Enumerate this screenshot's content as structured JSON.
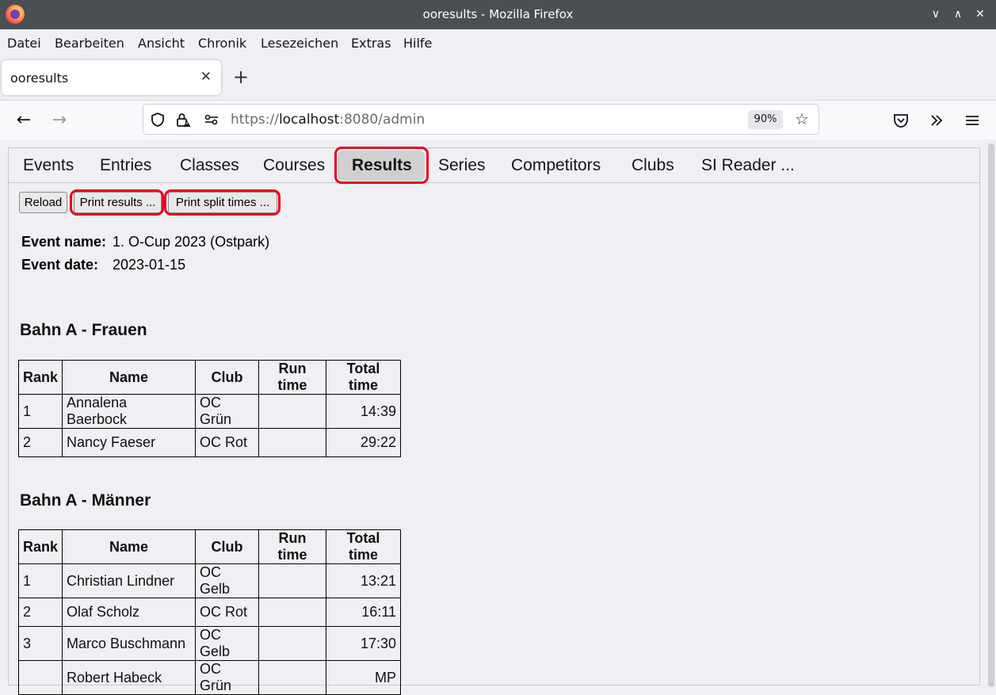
{
  "window": {
    "title": "ooresults - Mozilla Firefox"
  },
  "menu": [
    "Datei",
    "Bearbeiten",
    "Ansicht",
    "Chronik",
    "Lesezeichen",
    "Extras",
    "Hilfe"
  ],
  "tab": {
    "title": "ooresults"
  },
  "nav": {
    "url_scheme": "https://",
    "url_host": "localhost",
    "url_rest": ":8080/admin",
    "zoom": "90%"
  },
  "app_tabs": [
    "Events",
    "Entries",
    "Classes",
    "Courses",
    "Results",
    "Series",
    "Competitors",
    "Clubs",
    "SI Reader ..."
  ],
  "active_tab": "Results",
  "buttons": {
    "reload": "Reload",
    "print_results": "Print results ...",
    "print_split": "Print split times ..."
  },
  "event": {
    "name_label": "Event name:",
    "name_value": "1. O-Cup 2023 (Ostpark)",
    "date_label": "Event date:",
    "date_value": "2023-01-15"
  },
  "columns": [
    "Rank",
    "Name",
    "Club",
    "Run time",
    "Total time"
  ],
  "sections": [
    {
      "title": "Bahn A - Frauen",
      "rows": [
        [
          "1",
          "Annalena Baerbock",
          "OC Grün",
          "",
          "14:39"
        ],
        [
          "2",
          "Nancy Faeser",
          "OC Rot",
          "",
          "29:22"
        ]
      ]
    },
    {
      "title": "Bahn A - Männer",
      "rows": [
        [
          "1",
          "Christian Lindner",
          "OC Gelb",
          "",
          "13:21"
        ],
        [
          "2",
          "Olaf Scholz",
          "OC Rot",
          "",
          "16:11"
        ],
        [
          "3",
          "Marco Buschmann",
          "OC Gelb",
          "",
          "17:30"
        ],
        [
          "",
          "Robert Habeck",
          "OC Grün",
          "",
          "MP"
        ]
      ]
    }
  ],
  "colors": {
    "highlight": "#e8001f",
    "titlebar": "#4a4f54"
  }
}
